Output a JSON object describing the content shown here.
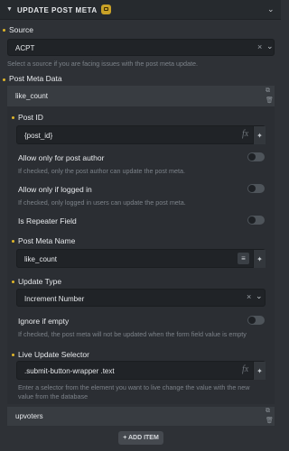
{
  "header": {
    "title": "UPDATE POST META"
  },
  "source": {
    "label": "Source",
    "value": "ACPT",
    "help": "Select a source if you are facing issues with the post meta update."
  },
  "post_meta_data": {
    "label": "Post Meta Data",
    "items": [
      {
        "label": "like_count"
      },
      {
        "label": "upvoters"
      }
    ],
    "fields": {
      "post_id": {
        "label": "Post ID",
        "value": "{post_id}"
      },
      "allow_author": {
        "label": "Allow only for post author",
        "help": "If checked, only the post author can update the post meta."
      },
      "allow_logged_in": {
        "label": "Allow only if logged in",
        "help": "If checked, only logged in users can update the post meta."
      },
      "repeater": {
        "label": "Is Repeater Field"
      },
      "meta_name": {
        "label": "Post Meta Name",
        "value": "like_count"
      },
      "update_type": {
        "label": "Update Type",
        "value": "Increment Number"
      },
      "ignore_empty": {
        "label": "Ignore if empty",
        "help": "If checked, the post meta will not be updated when the form field value is empty"
      },
      "live_selector": {
        "label": "Live Update Selector",
        "value": ".submit-button-wrapper .text",
        "help_line1": "Enter a selector from the element you want to live change the value with the new",
        "help_line2": "value from the database"
      }
    },
    "add_item": "+ ADD ITEM"
  },
  "colors": {
    "accent": "#e0b62a",
    "background": "#2e3136",
    "input": "#202327"
  }
}
